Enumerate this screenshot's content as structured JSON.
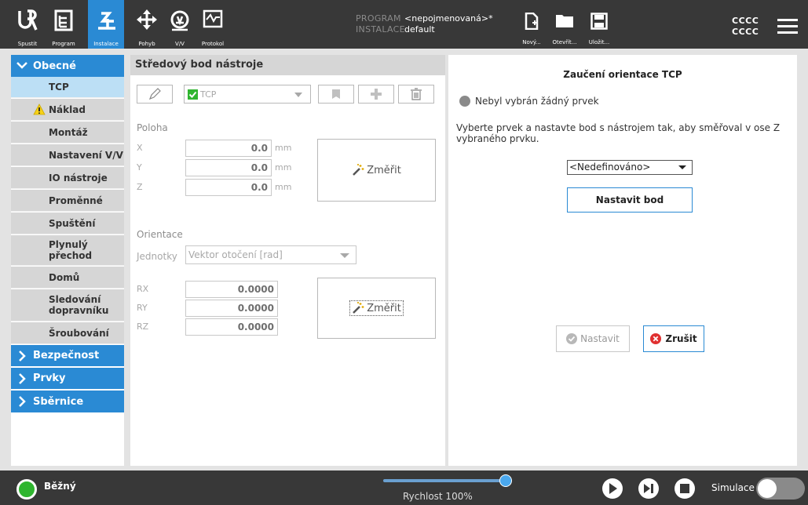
{
  "topbar": {
    "nav": [
      {
        "label": "Spustit",
        "icon": "ur-logo-icon"
      },
      {
        "label": "Program",
        "icon": "program-icon"
      },
      {
        "label": "Instalace",
        "icon": "installation-icon",
        "active": true
      },
      {
        "label": "Pohyb",
        "icon": "move-icon"
      },
      {
        "label": "V/V",
        "icon": "io-icon"
      },
      {
        "label": "Protokol",
        "icon": "log-icon"
      }
    ],
    "program_key": "PROGRAM",
    "program_value": "<nepojmenovaná>*",
    "installation_key": "INSTALACE",
    "installation_value": "default",
    "file": {
      "new_label": "Nový...",
      "open_label": "Otevřít...",
      "save_label": "Uložit..."
    },
    "right_line1": "CCCC",
    "right_line2": "CCCC"
  },
  "leftnav": {
    "general": "Obecné",
    "items": [
      {
        "label": "TCP",
        "active": true
      },
      {
        "label": "Náklad",
        "warning": true
      },
      {
        "label": "Montáž"
      },
      {
        "label": "Nastavení V/V"
      },
      {
        "label": "IO nástroje"
      },
      {
        "label": "Proměnné"
      },
      {
        "label": "Spuštění"
      },
      {
        "label": "Plynulý přechod"
      },
      {
        "label": "Domů"
      },
      {
        "label": "Sledování dopravníku"
      },
      {
        "label": "Šroubování"
      }
    ],
    "safety": "Bezpečnost",
    "features": "Prvky",
    "fieldbus": "Sběrnice"
  },
  "mid": {
    "header": "Středový bod nástroje",
    "tcp_name": "TCP",
    "position_label": "Poloha",
    "position": [
      {
        "axis": "X",
        "value": "0.0",
        "unit": "mm"
      },
      {
        "axis": "Y",
        "value": "0.0",
        "unit": "mm"
      },
      {
        "axis": "Z",
        "value": "0.0",
        "unit": "mm"
      }
    ],
    "measure_label": "Změřit",
    "orientation_label": "Orientace",
    "units_label": "Jednotky",
    "units_value": "Vektor otočení [rad]",
    "orientation": [
      {
        "axis": "RX",
        "value": "0.0000"
      },
      {
        "axis": "RY",
        "value": "0.0000"
      },
      {
        "axis": "RZ",
        "value": "0.0000"
      }
    ]
  },
  "right": {
    "title": "Zaučení orientace TCP",
    "feature_status": "Nebyl vybrán žádný prvek",
    "instructions": "Vyberte prvek a nastavte bod s nástrojem tak, aby směřoval v ose Z vybraného prvku.",
    "feature_select": "<Nedefinováno>",
    "set_point_label": "Nastavit bod",
    "set_label": "Nastavit",
    "cancel_label": "Zrušit"
  },
  "bottombar": {
    "status": "Běžný",
    "speed_label": "Rychlost 100%",
    "speed_fraction": 1.0,
    "sim_label": "Simulace",
    "status_color": "#2fb52f",
    "accent_color": "#2a8ad4"
  }
}
